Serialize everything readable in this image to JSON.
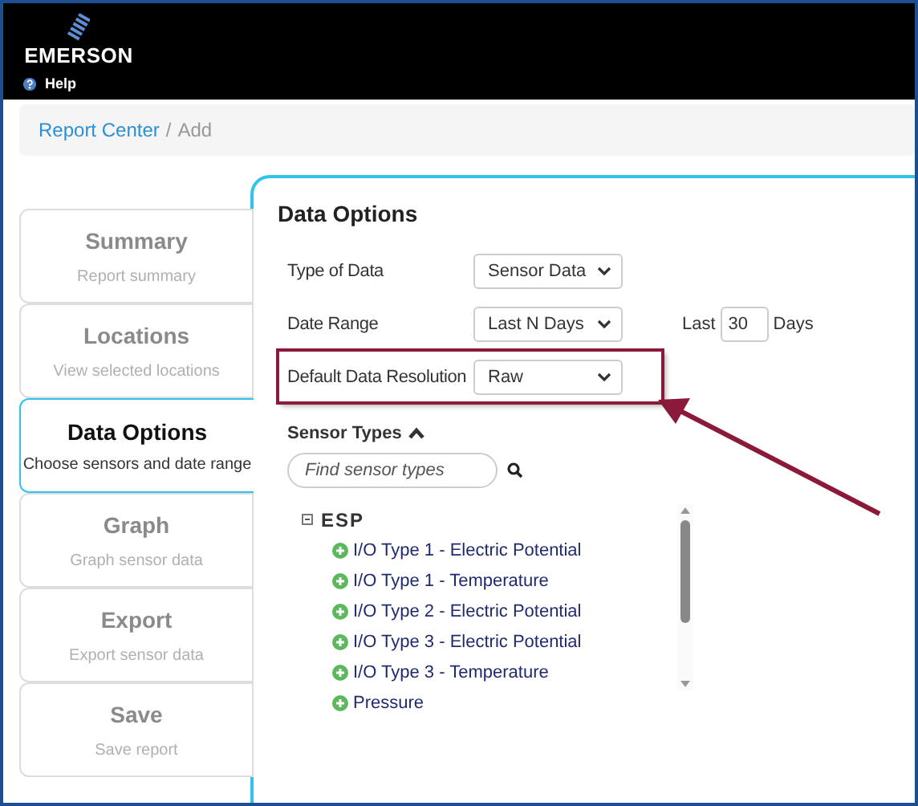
{
  "header": {
    "logo": "EMERSON",
    "help": "Help"
  },
  "breadcrumb_separator": "/",
  "breadcrumb": [
    {
      "label": "Report Center",
      "kind": "link"
    },
    {
      "label": "Add",
      "kind": "current"
    }
  ],
  "steps": [
    {
      "title": "Summary",
      "subtitle": "Report summary",
      "selected": false
    },
    {
      "title": "Locations",
      "subtitle": "View selected locations",
      "selected": false
    },
    {
      "title": "Data Options",
      "subtitle": "Choose sensors and date range",
      "selected": true
    },
    {
      "title": "Graph",
      "subtitle": "Graph sensor data",
      "selected": false
    },
    {
      "title": "Export",
      "subtitle": "Export sensor data",
      "selected": false
    },
    {
      "title": "Save",
      "subtitle": "Save report",
      "selected": false
    }
  ],
  "panel": {
    "title": "Data Options",
    "fields": [
      {
        "label": "Type of Data",
        "value": "Sensor Data",
        "highlighted": false
      },
      {
        "label": "Date Range",
        "value": "Last N Days",
        "highlighted": false,
        "extra": {
          "prefix": "Last",
          "value": "30",
          "suffix": "Days"
        }
      },
      {
        "label": "Default Data Resolution",
        "value": "Raw",
        "highlighted": true
      }
    ],
    "sensor_types": {
      "title": "Sensor Types",
      "expanded": true,
      "search": {
        "placeholder": "Find sensor types"
      },
      "tree": [
        {
          "label": "ESP",
          "expanded": true,
          "children": [
            {
              "label": "I/O Type 1 - Electric Potential"
            },
            {
              "label": "I/O Type 1 - Temperature"
            },
            {
              "label": "I/O Type 2 - Electric Potential"
            },
            {
              "label": "I/O Type 3 - Electric Potential"
            },
            {
              "label": "I/O Type 3 - Temperature"
            },
            {
              "label": "Pressure"
            }
          ]
        }
      ]
    }
  }
}
